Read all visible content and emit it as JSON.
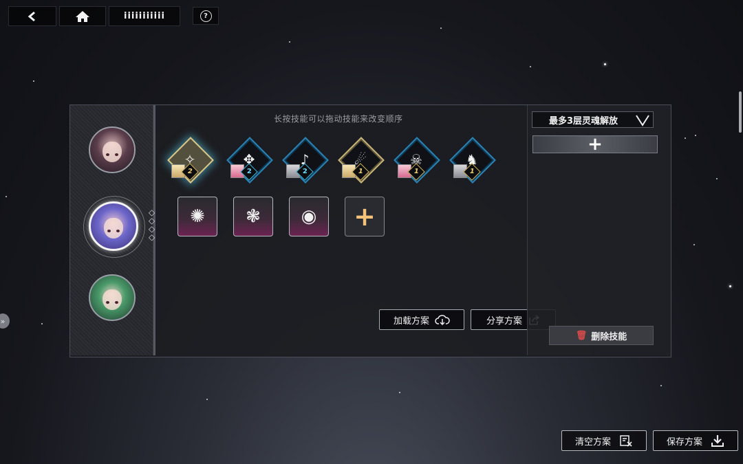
{
  "nav": {
    "back_icon": "chevron-left-icon",
    "home_icon": "home-icon",
    "title": "iiiiiiiiiii",
    "help_label": "?"
  },
  "panel": {
    "hint": "长按技能可以拖动技能来改变顺序",
    "characters": [
      {
        "name": "character-1",
        "selected": false
      },
      {
        "name": "character-2",
        "selected": true
      },
      {
        "name": "character-3",
        "selected": false
      }
    ],
    "skills": [
      {
        "glyph": "✧",
        "level": "2",
        "frame": "gold",
        "selected": true,
        "portrait": "blonde"
      },
      {
        "glyph": "✥",
        "level": "2",
        "frame": "blue",
        "selected": false,
        "portrait": "pink"
      },
      {
        "glyph": "♪",
        "level": "2",
        "frame": "blue",
        "selected": false,
        "portrait": "grey"
      },
      {
        "glyph": "☄",
        "level": "1",
        "frame": "gold",
        "selected": false,
        "portrait": "blonde"
      },
      {
        "glyph": "☠",
        "level": "1",
        "frame": "blue",
        "selected": false,
        "portrait": "pink"
      },
      {
        "glyph": "♞",
        "level": "1",
        "frame": "blue",
        "selected": false,
        "portrait": "grey"
      }
    ],
    "passives": [
      {
        "glyph": "✺"
      },
      {
        "glyph": "❃"
      },
      {
        "glyph": "◉"
      }
    ],
    "add_passive_label": "+",
    "load_button": "加载方案",
    "share_button": "分享方案"
  },
  "right_col": {
    "dropdown_label": "最多3层灵魂解放",
    "add_label": "+",
    "delete_label": "删除技能"
  },
  "bottom": {
    "clear_label": "清空方案",
    "save_label": "保存方案"
  },
  "colors": {
    "accent_blue": "#2b84b5",
    "accent_gold": "#c9b77a",
    "delete_red": "#d24a4a",
    "plus_orange": "#f4c27a"
  }
}
